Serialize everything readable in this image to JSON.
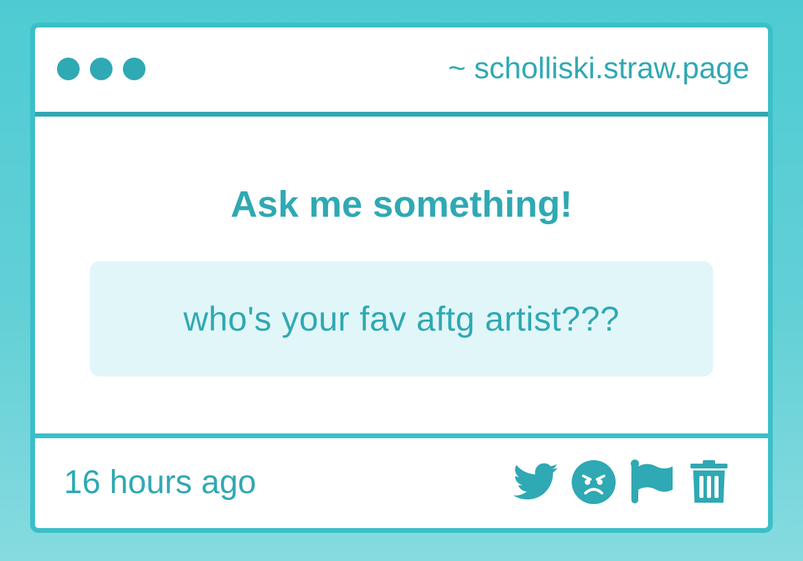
{
  "window": {
    "url": "~ scholliski.straw.page"
  },
  "main": {
    "heading": "Ask me something!",
    "question": "who's your fav aftg artist???"
  },
  "footer": {
    "timestamp": "16 hours ago",
    "actions": [
      {
        "icon": "twitter-icon"
      },
      {
        "icon": "angry-face-icon"
      },
      {
        "icon": "flag-icon"
      },
      {
        "icon": "trash-icon"
      }
    ]
  },
  "colors": {
    "accent": "#2fa9b3",
    "border": "#3bbfc8",
    "question_bg": "#e1f6f8",
    "background": "#4ecbd2"
  }
}
